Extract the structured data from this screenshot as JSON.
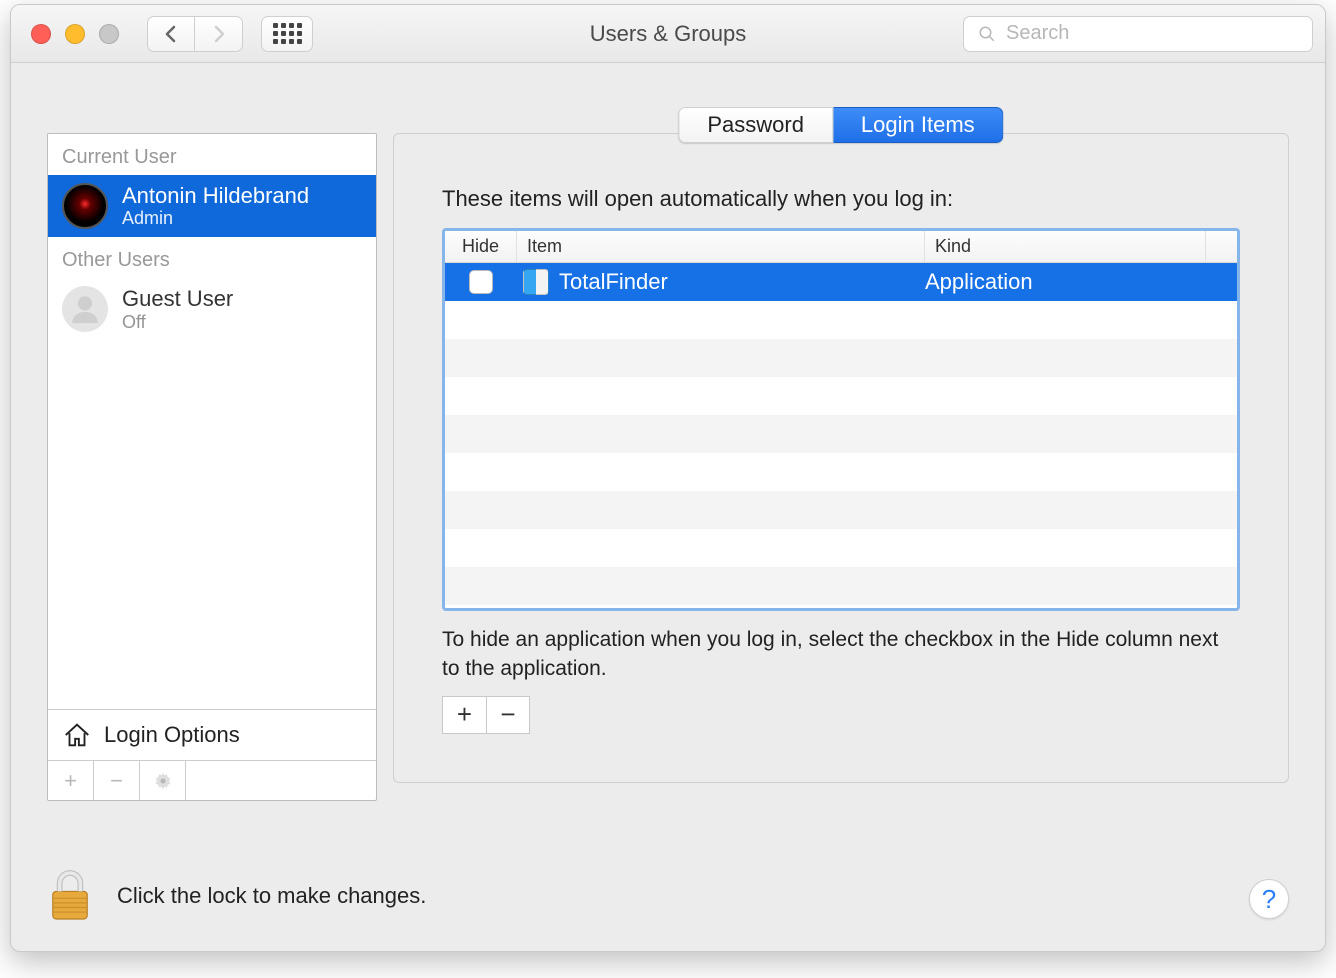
{
  "window": {
    "title": "Users & Groups"
  },
  "search": {
    "placeholder": "Search"
  },
  "sidebar": {
    "current_label": "Current User",
    "other_label": "Other Users",
    "current_user": {
      "name": "Antonin Hildebrand",
      "role": "Admin"
    },
    "other_users": [
      {
        "name": "Guest User",
        "role": "Off"
      }
    ],
    "login_options": "Login Options"
  },
  "tabs": {
    "password": "Password",
    "login_items": "Login Items"
  },
  "panel": {
    "heading": "These items will open automatically when you log in:",
    "columns": {
      "hide": "Hide",
      "item": "Item",
      "kind": "Kind"
    },
    "rows": [
      {
        "item": "TotalFinder",
        "kind": "Application",
        "hide": false
      }
    ],
    "hint": "To hide an application when you log in, select the checkbox in the Hide column next to the application."
  },
  "footer": {
    "lock_text": "Click the lock to make changes."
  },
  "glyphs": {
    "plus": "+",
    "minus": "−",
    "help": "?"
  }
}
